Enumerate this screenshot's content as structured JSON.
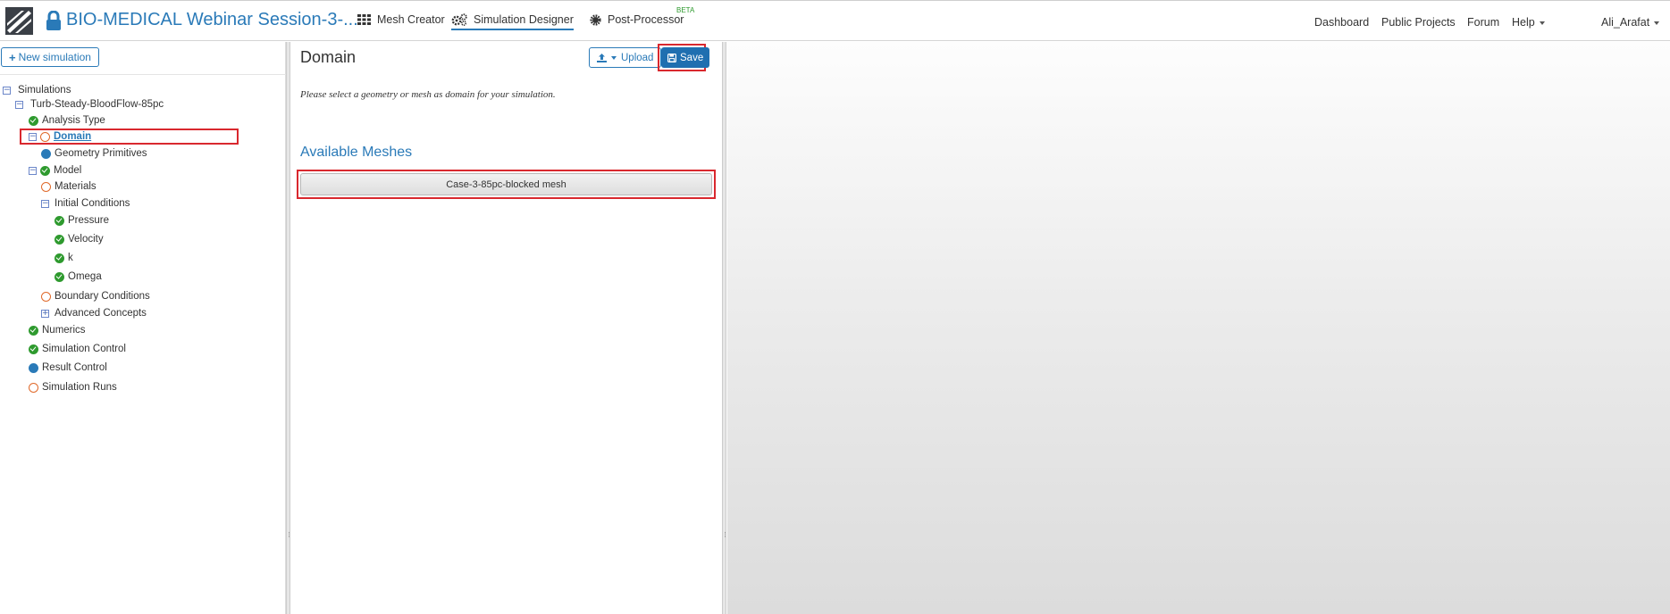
{
  "header": {
    "project_title": "BIO-MEDICAL Webinar Session-3-...",
    "tabs": [
      {
        "label": "Mesh Creator",
        "icon": "grid-icon"
      },
      {
        "label": "Simulation Designer",
        "icon": "gears-icon",
        "active": true
      },
      {
        "label": "Post-Processor",
        "icon": "cog-icon",
        "badge": "BETA"
      }
    ],
    "links": {
      "dashboard": "Dashboard",
      "public_projects": "Public Projects",
      "forum": "Forum",
      "help": "Help",
      "user": "Ali_Arafat"
    }
  },
  "sidebar": {
    "new_simulation": "New simulation",
    "tree": {
      "root": "Simulations",
      "simulation": "Turb-Steady-BloodFlow-85pc",
      "analysis_type": "Analysis Type",
      "domain": "Domain",
      "geometry_primitives": "Geometry Primitives",
      "model": "Model",
      "materials": "Materials",
      "initial_conditions": "Initial Conditions",
      "pressure": "Pressure",
      "velocity": "Velocity",
      "k": "k",
      "omega": "Omega",
      "boundary_conditions": "Boundary Conditions",
      "advanced_concepts": "Advanced Concepts",
      "numerics": "Numerics",
      "simulation_control": "Simulation Control",
      "result_control": "Result Control",
      "simulation_runs": "Simulation Runs"
    }
  },
  "main": {
    "title": "Domain",
    "upload_label": "Upload",
    "save_label": "Save",
    "hint": "Please select a geometry or mesh as domain for your simulation.",
    "available_meshes_title": "Available Meshes",
    "meshes": [
      "Case-3-85pc-blocked mesh"
    ]
  },
  "colors": {
    "accent": "#2a7ab8",
    "ok": "#2e9a2e",
    "pending": "#e0692a",
    "highlight": "#d9282e"
  }
}
